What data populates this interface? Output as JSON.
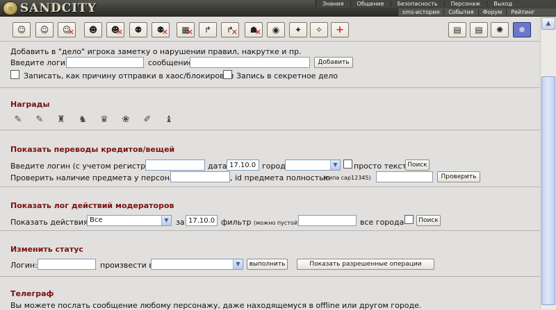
{
  "header": {
    "logo": {
      "text": "SANDCITY",
      "emblem_icon": "sandcity-emblem"
    },
    "nav_primary": [
      "Знания",
      "Общение",
      "Безопасность",
      "Персонаж",
      "Выход"
    ],
    "nav_secondary": [
      "sms-история",
      "События",
      "Форум",
      "Рейтинг"
    ]
  },
  "toolbar": {
    "icons": [
      "silence-icon",
      "silence-long-icon",
      "remove-silence-icon",
      "forum-silence-icon",
      "remove-forum-silence-icon",
      "block-icon",
      "remove-block-icon",
      "jail-icon",
      "remove-jail-icon",
      "chaos-icon",
      "remove-chaos-icon",
      "mask-icon",
      "stealth-icon",
      "magic-icon",
      "magic-remove-icon",
      "heal-icon",
      "scroll-icon",
      "scroll-2-icon",
      "sun-icon",
      "info-icon"
    ]
  },
  "note_section": {
    "description": "Добавить в \"дело\" игрока заметку о нарушении правил, накрутке и пр.",
    "login_label": "Введите логин",
    "message_label": "сообщение",
    "add_button": "Добавить",
    "chaos_reason_label": "Записать, как причину отправки в хаос/блокировки",
    "secret_record_label": "Запись в секретное дело"
  },
  "awards": {
    "title": "Награды",
    "icons": [
      "award-1-icon",
      "award-2-icon",
      "award-3-icon",
      "award-4-icon",
      "award-5-icon",
      "award-6-icon",
      "award-7-icon",
      "award-8-icon"
    ]
  },
  "transfers": {
    "title": "Показать переводы кредитов/вещей",
    "login_label": "Введите логин (с учетом регистра!)",
    "date_label": "дата",
    "date_value": "17.10.06",
    "city_label": "город",
    "plain_text_label": "просто текст",
    "search_button": "Поиск",
    "item_check_label": "Проверить наличие предмета у персонажа",
    "item_id_label": ", id предмета полностью",
    "item_id_hint": "(типа cap12345)",
    "check_button": "Проверить"
  },
  "moderator_log": {
    "title": "Показать лог действий модераторов",
    "actions_label": "Показать действия:",
    "actions_selected": "Все",
    "for_label": "за",
    "date_value": "17.10.06",
    "filter_label": "фильтр",
    "filter_hint": "(можно пустой)",
    "all_cities_label": "все города",
    "search_button": "Поиск"
  },
  "status": {
    "title": "Изменить статус",
    "login_label": "Логин:",
    "produce_label": "произвести в",
    "execute_button": "выполнить",
    "allowed_ops_button": "Показать разрешенные операции"
  },
  "telegraph": {
    "title": "Телеграф",
    "description": "Вы можете послать сообщение любому персонажу, даже находящемуся в offline или другом городе."
  }
}
